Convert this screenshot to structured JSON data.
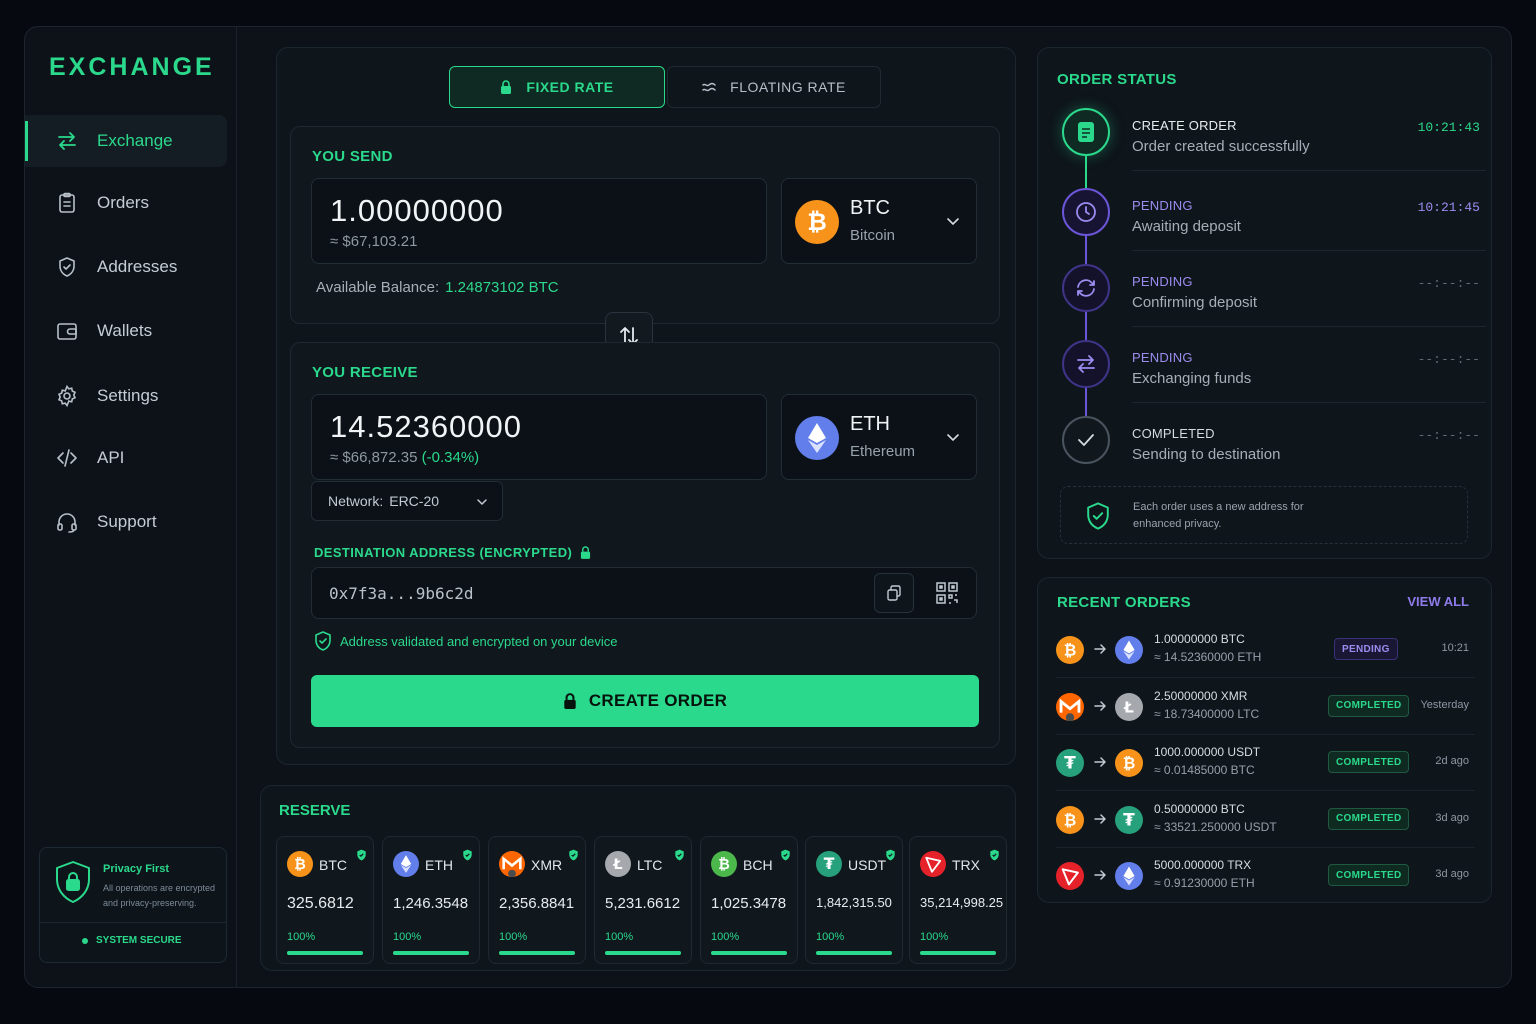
{
  "app": {
    "logo": "EXCHANGE"
  },
  "sidebar": {
    "items": [
      {
        "label": "Exchange",
        "icon": "exchange-icon",
        "active": true
      },
      {
        "label": "Orders",
        "icon": "clipboard-icon"
      },
      {
        "label": "Addresses",
        "icon": "shield-check-icon"
      },
      {
        "label": "Wallets",
        "icon": "wallet-icon"
      },
      {
        "label": "Settings",
        "icon": "gear-icon"
      },
      {
        "label": "API",
        "icon": "code-icon"
      },
      {
        "label": "Support",
        "icon": "headset-icon"
      }
    ],
    "privacy": {
      "title": "Privacy First",
      "desc": "All operations are encrypted and privacy-preserving.",
      "status": "SYSTEM SECURE"
    }
  },
  "exchange": {
    "tabs": {
      "fixed": "FIXED RATE",
      "floating": "FLOATING RATE"
    },
    "send": {
      "label": "YOU SEND",
      "amount": "1.00000000",
      "usd": "≈ $67,103.21",
      "coin_symbol": "BTC",
      "coin_name": "Bitcoin",
      "balance_label": "Available Balance:",
      "balance_value": "1.24873102 BTC"
    },
    "receive": {
      "label": "YOU RECEIVE",
      "amount": "14.52360000",
      "usd": "≈ $66,872.35",
      "change": "(-0.34%)",
      "coin_symbol": "ETH",
      "coin_name": "Ethereum",
      "network_label": "Network:",
      "network_value": "ERC-20"
    },
    "destination": {
      "label": "DESTINATION ADDRESS (ENCRYPTED)",
      "value": "0x7f3a...9b6c2d",
      "validated": "Address validated and encrypted on your device"
    },
    "create_button": "CREATE ORDER"
  },
  "reserve": {
    "title": "RESERVE",
    "items": [
      {
        "symbol": "BTC",
        "value": "325.6812",
        "pct": "100%",
        "fill": 1.0,
        "color": "#f7931a"
      },
      {
        "symbol": "ETH",
        "value": "1,246.3548",
        "pct": "100%",
        "fill": 1.0,
        "color": "#627eea"
      },
      {
        "symbol": "XMR",
        "value": "2,356.8841",
        "pct": "100%",
        "fill": 1.0,
        "color": "#ff6600"
      },
      {
        "symbol": "LTC",
        "value": "5,231.6612",
        "pct": "100%",
        "fill": 1.0,
        "color": "#a5a9ae"
      },
      {
        "symbol": "BCH",
        "value": "1,025.3478",
        "pct": "100%",
        "fill": 1.0,
        "color": "#4cb84c"
      },
      {
        "symbol": "USDT",
        "value": "1,842,315.50",
        "pct": "100%",
        "fill": 1.0,
        "color": "#26a17b"
      },
      {
        "symbol": "TRX",
        "value": "35,214,998.25",
        "pct": "100%",
        "fill": 1.0,
        "color": "#e5222a"
      }
    ]
  },
  "order_status": {
    "title": "ORDER STATUS",
    "steps": [
      {
        "title": "CREATE ORDER",
        "desc": "Order created successfully",
        "time": "10:21:43",
        "state": "done"
      },
      {
        "title": "PENDING",
        "desc": "Awaiting deposit",
        "time": "10:21:45",
        "state": "active"
      },
      {
        "title": "PENDING",
        "desc": "Confirming deposit",
        "time": "--:--:--",
        "state": "pending"
      },
      {
        "title": "PENDING",
        "desc": "Exchanging funds",
        "time": "--:--:--",
        "state": "pending"
      },
      {
        "title": "COMPLETED",
        "desc": "Sending to destination",
        "time": "--:--:--",
        "state": "future"
      }
    ],
    "note": "Each order uses a new address for enhanced privacy."
  },
  "recent_orders": {
    "title": "RECENT ORDERS",
    "view_all": "VIEW ALL",
    "rows": [
      {
        "from": "BTC",
        "to": "ETH",
        "amount": "1.00000000 BTC",
        "approx": "≈ 14.52360000 ETH",
        "status": "PENDING",
        "time": "10:21"
      },
      {
        "from": "XMR",
        "to": "LTC",
        "amount": "2.50000000 XMR",
        "approx": "≈ 18.73400000 LTC",
        "status": "COMPLETED",
        "time": "Yesterday"
      },
      {
        "from": "USDT",
        "to": "BTC",
        "amount": "1000.000000 USDT",
        "approx": "≈ 0.01485000 BTC",
        "status": "COMPLETED",
        "time": "2d ago"
      },
      {
        "from": "BTC",
        "to": "USDT",
        "amount": "0.50000000 BTC",
        "approx": "≈ 33521.250000 USDT",
        "status": "COMPLETED",
        "time": "3d ago"
      },
      {
        "from": "TRX",
        "to": "ETH",
        "amount": "5000.000000 TRX",
        "approx": "≈ 0.91230000 ETH",
        "status": "COMPLETED",
        "time": "3d ago"
      }
    ]
  }
}
